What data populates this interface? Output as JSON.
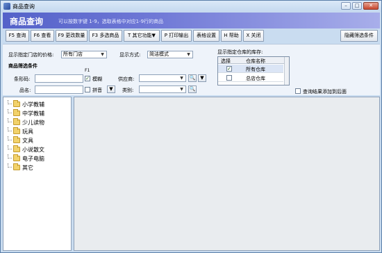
{
  "window": {
    "title": "商品查询"
  },
  "header": {
    "title": "商品查询",
    "hint": "可以按数字键 1-9，选取表格中对应1-9行的商品"
  },
  "toolbar": {
    "buttons": [
      {
        "key": "query",
        "label": "F5 查询"
      },
      {
        "key": "view",
        "label": "F6 查看"
      },
      {
        "key": "change_qty",
        "label": "F9 更改数量"
      },
      {
        "key": "multi_select",
        "label": "F3 多选商品"
      },
      {
        "key": "other",
        "label": "T 其它功能▼"
      },
      {
        "key": "print",
        "label": "P 打印输出"
      },
      {
        "key": "table_settings",
        "label": "表格设置"
      },
      {
        "key": "help",
        "label": "H 帮助"
      },
      {
        "key": "close",
        "label": "X 关闭"
      },
      {
        "key": "hide_filter",
        "label": "隐藏筛选条件"
      }
    ]
  },
  "form": {
    "price_label": "显示指定门店的价格:",
    "price_store": "所有门店",
    "display_mode_label": "显示方式:",
    "display_mode": "简洁模式",
    "warehouse_label": "显示指定仓库的库存:",
    "filter_title": "商品筛选条件",
    "barcode_label": "条形码:",
    "name_label": "品名:",
    "f1_label": "F1",
    "fuzzy_label": "模糊",
    "pinyin_label": "拼音",
    "supplier_label": "供应商:",
    "category_label": "类别:",
    "append_label": "查询结果添加到后面"
  },
  "warehouses": {
    "col_select": "选择",
    "col_name": "仓库名称",
    "rows": [
      {
        "name": "所有仓库",
        "checked": true
      },
      {
        "name": "总店仓库",
        "checked": false
      }
    ]
  },
  "tree": {
    "items": [
      "小学教辅",
      "中学教辅",
      "少儿读物",
      "玩具",
      "文具",
      "小说散文",
      "电子电脑",
      "其它"
    ]
  }
}
